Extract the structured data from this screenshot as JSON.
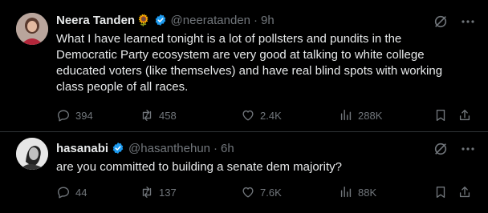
{
  "tweets": [
    {
      "author_name": "Neera Tanden",
      "emoji": "🌻",
      "handle": "@neeratanden",
      "time": "9h",
      "text": "What I have learned tonight is a lot of pollsters and pundits in the Democratic Party ecosystem are very good at talking to white college educated voters (like themselves) and have real blind spots with working class people of all races.",
      "replies": "394",
      "reposts": "458",
      "likes": "2.4K",
      "views": "288K"
    },
    {
      "author_name": "hasanabi",
      "handle": "@hasanthehun",
      "time": "6h",
      "text": "are you committed to building a senate dem majority?",
      "replies": "44",
      "reposts": "137",
      "likes": "7.6K",
      "views": "88K"
    }
  ],
  "separator": "·",
  "colors": {
    "background": "#000000",
    "text": "#e7e9ea",
    "muted": "#71767b",
    "verified": "#1d9bf0",
    "divider": "#2f3336"
  }
}
